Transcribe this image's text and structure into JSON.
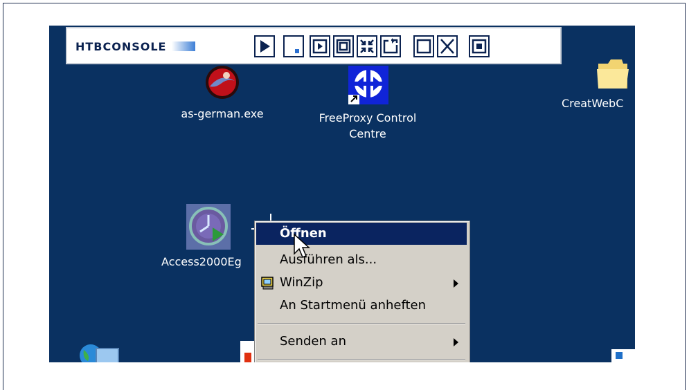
{
  "toolbar": {
    "brand": "HTBCONSOLE",
    "buttons": [
      {
        "name": "play-button-icon"
      },
      {
        "name": "minimize-button-icon"
      },
      {
        "name": "window-small-icon"
      },
      {
        "name": "window-restore-icon"
      },
      {
        "name": "shrink-icon"
      },
      {
        "name": "rotate-window-icon"
      },
      {
        "name": "maximize-icon"
      },
      {
        "name": "close-x-icon"
      },
      {
        "name": "fullscreen-icon"
      }
    ]
  },
  "desktop_icons": {
    "as_german": "as-german.exe",
    "freeproxy_line1": "FreeProxy Control",
    "freeproxy_line2": "Centre",
    "creatweb": "CreatWebC",
    "access": "Access2000Eg"
  },
  "context_menu": {
    "open": "Öffnen",
    "run_as": "Ausführen als...",
    "winzip": "WinZip",
    "pin_start": "An Startmenü anheften",
    "send_to": "Senden an"
  },
  "colors": {
    "desktop": "#0a3161",
    "menu_bg": "#d4d0c8",
    "selection": "#0a2460",
    "brand": "#0b2250"
  }
}
